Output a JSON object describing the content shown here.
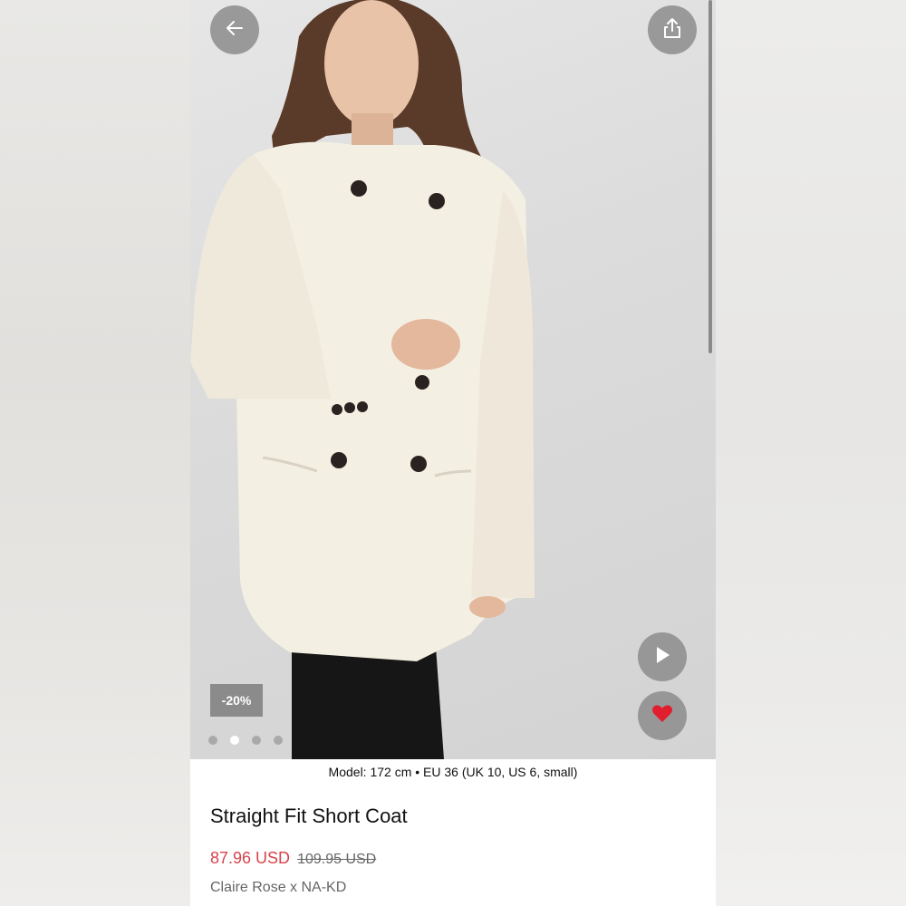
{
  "product": {
    "model_info": "Model: 172 cm • EU 36 (UK 10, US 6, small)",
    "title": "Straight Fit Short Coat",
    "price_current": "87.96 USD",
    "price_original": "109.95 USD",
    "brand": "Claire Rose x NA-KD",
    "discount_badge": "-20%"
  },
  "gallery": {
    "image_count": 4,
    "active_index": 1
  },
  "icons": {
    "back": "arrow-left-icon",
    "share": "share-icon",
    "play": "play-icon",
    "favorite": "heart-icon"
  },
  "colors": {
    "price_accent": "#d8434b",
    "favorite_heart": "#e01e2d",
    "button_bg": "#8c8c8c"
  }
}
